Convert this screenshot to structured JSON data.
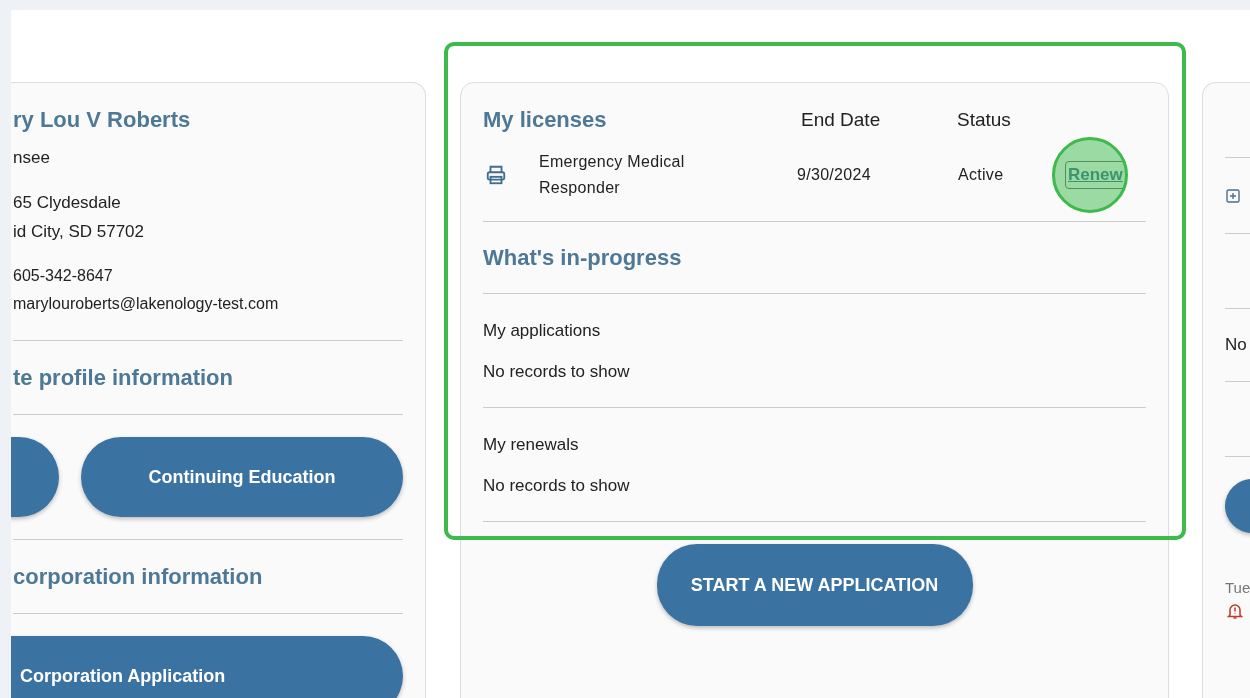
{
  "profile": {
    "name": "ry Lou V Roberts",
    "role": "nsee",
    "address_lines": [
      "65 Clydesdale",
      "id City, SD 57702"
    ],
    "phone": "605-342-8647",
    "email": "marylouroberts@lakenology-test.com"
  },
  "profile_section": {
    "title": "te profile information",
    "button": "Continuing Education"
  },
  "corporation_section": {
    "title": "corporation information",
    "button": "Corporation Application"
  },
  "licenses": {
    "title": "My licenses",
    "columns": [
      "End Date",
      "Status"
    ],
    "rows": [
      {
        "name": "Emergency Medical Responder",
        "end_date": "9/30/2024",
        "status": "Active",
        "action": "Renew"
      }
    ]
  },
  "in_progress": {
    "title": "What's in-progress",
    "sections": [
      {
        "title": "My applications",
        "empty_text": "No records to show"
      },
      {
        "title": "My renewals",
        "empty_text": "No records to show"
      }
    ]
  },
  "start_button": "START A NEW APPLICATION",
  "right_panel": {
    "text": "No",
    "date": "Tue"
  }
}
